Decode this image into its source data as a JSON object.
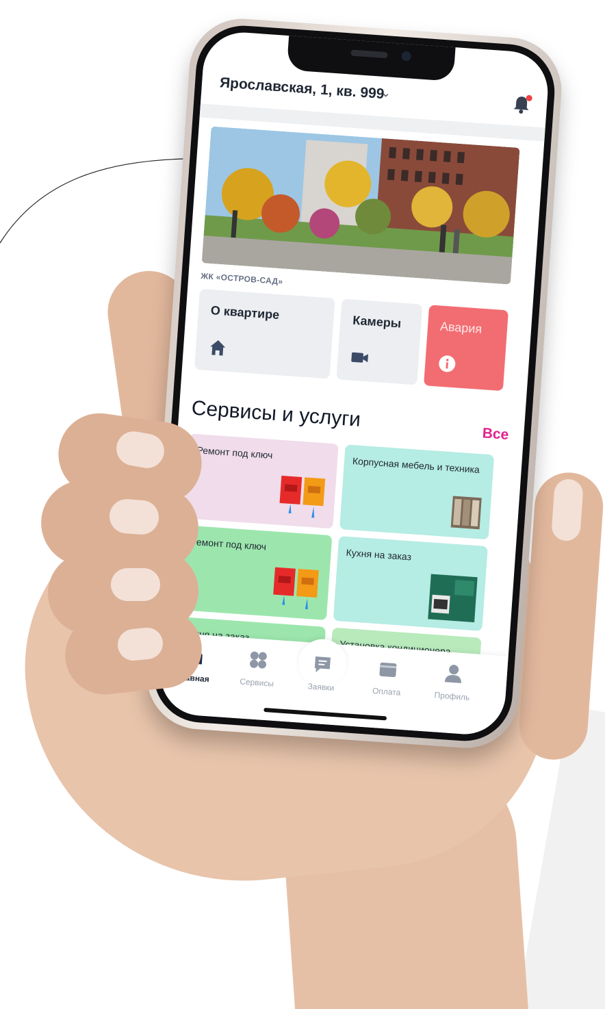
{
  "header": {
    "address": "Ярославская, 1, кв. 999",
    "chevron_icon": "chevron-down-icon",
    "bell_icon": "bell-icon"
  },
  "complex_name": "ЖК «ОСТРОВ-САД»",
  "quick_tiles": [
    {
      "label": "О квартире",
      "icon": "home-icon"
    },
    {
      "label": "Камеры",
      "icon": "video-camera-icon"
    },
    {
      "label": "Авария",
      "icon": "info-icon"
    }
  ],
  "services": {
    "title": "Сервисы и услуги",
    "all_link": "Все",
    "cards": [
      {
        "label": "Ремонт под ключ"
      },
      {
        "label": "Корпусная мебель и техника"
      },
      {
        "label": "Ремонт под ключ"
      },
      {
        "label": "Кухня на заказ"
      },
      {
        "label": "Кухня на заказ"
      },
      {
        "label": "Установка кондиционера"
      }
    ]
  },
  "tabbar": [
    {
      "label": "Главная",
      "icon": "home-icon"
    },
    {
      "label": "Сервисы",
      "icon": "grid-icon"
    },
    {
      "label": "Заявки",
      "icon": "chat-icon"
    },
    {
      "label": "Оплата",
      "icon": "wallet-icon"
    },
    {
      "label": "Профиль",
      "icon": "profile-icon"
    }
  ],
  "colors": {
    "accent": "#e0238e",
    "alarm": "#f26d72",
    "tile_gray": "#eceef1",
    "card_pink": "#f0dcea",
    "card_mint": "#b5ece3",
    "card_green": "#9ce6ad"
  }
}
